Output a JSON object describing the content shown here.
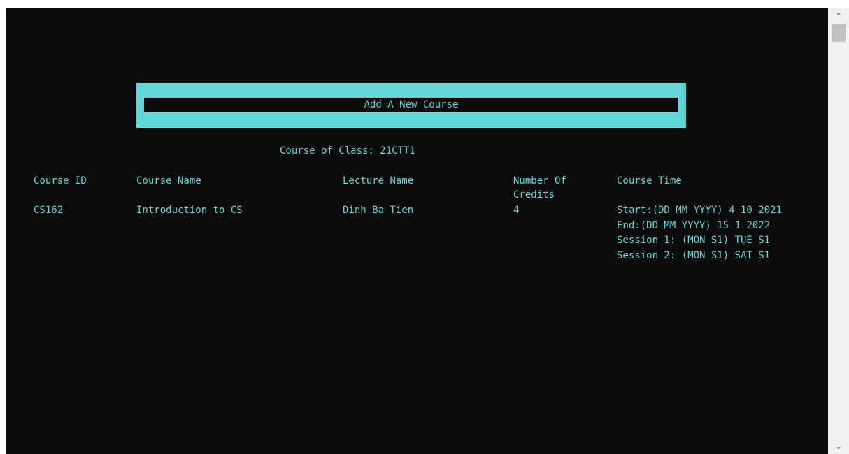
{
  "title": "Add A New Course",
  "class_line": "Course of Class: 21CTT1",
  "table": {
    "headers": {
      "course_id": "Course ID",
      "course_name": "Course Name",
      "lecturer": "Lecture Name",
      "credits_line1": "Number Of",
      "credits_line2": "Credits",
      "course_time": "Course Time"
    },
    "rows": [
      {
        "course_id": "CS162",
        "course_name": "Introduction to CS",
        "lecturer": "Dinh Ba Tien",
        "credits": "4",
        "time_start": "Start:(DD MM YYYY) 4 10 2021",
        "time_end": "End:(DD MM YYYY) 15 1 2022",
        "session1": "Session 1: (MON S1) TUE S1",
        "session2": "Session 2: (MON S1) SAT S1"
      }
    ]
  },
  "scrollbar": {
    "up_icon": "chevron-up-icon",
    "down_icon": "chevron-down-icon"
  },
  "colors": {
    "background": "#0c0c0c",
    "text": "#61d6d6"
  }
}
